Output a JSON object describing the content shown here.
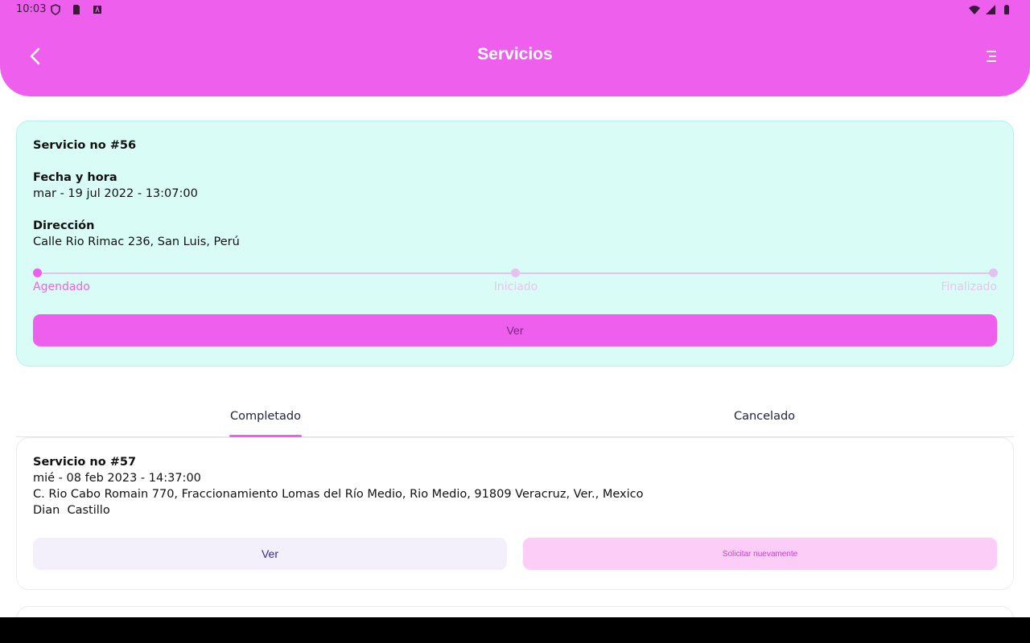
{
  "status": {
    "time": "10:03"
  },
  "header": {
    "title": "Servicios"
  },
  "active_service": {
    "title": "Servicio no #56",
    "date_label": "Fecha y hora",
    "date_value": "mar - 19 jul 2022 - 13:07:00",
    "address_label": "Dirección",
    "address_value": "Calle Rio Rimac 236, San Luis, Perú",
    "steps": [
      {
        "label": "Agendado",
        "active": true
      },
      {
        "label": "Iniciado",
        "active": false
      },
      {
        "label": "Finalizado",
        "active": false
      }
    ],
    "view_label": "Ver"
  },
  "tabs": [
    {
      "label": "Completado",
      "selected": true
    },
    {
      "label": "Cancelado",
      "selected": false
    }
  ],
  "history": [
    {
      "title": "Servicio no #57",
      "date": "mié - 08 feb 2023 - 14:37:00",
      "address": "C. Rio Cabo Romain 770, Fraccionamiento Lomas del Río Medio, Rio Medio, 91809 Veracruz, Ver., Mexico",
      "person": "Dian  Castillo",
      "view_label": "Ver",
      "again_label": "Solicitar nuevamente"
    }
  ],
  "colors": {
    "primary": "#ef5fee",
    "card_bg": "#d9fdf6",
    "step_inactive": "#e2c3ef",
    "ver_secondary_bg": "#f3f0fc",
    "again_bg": "#fbcdf7"
  }
}
